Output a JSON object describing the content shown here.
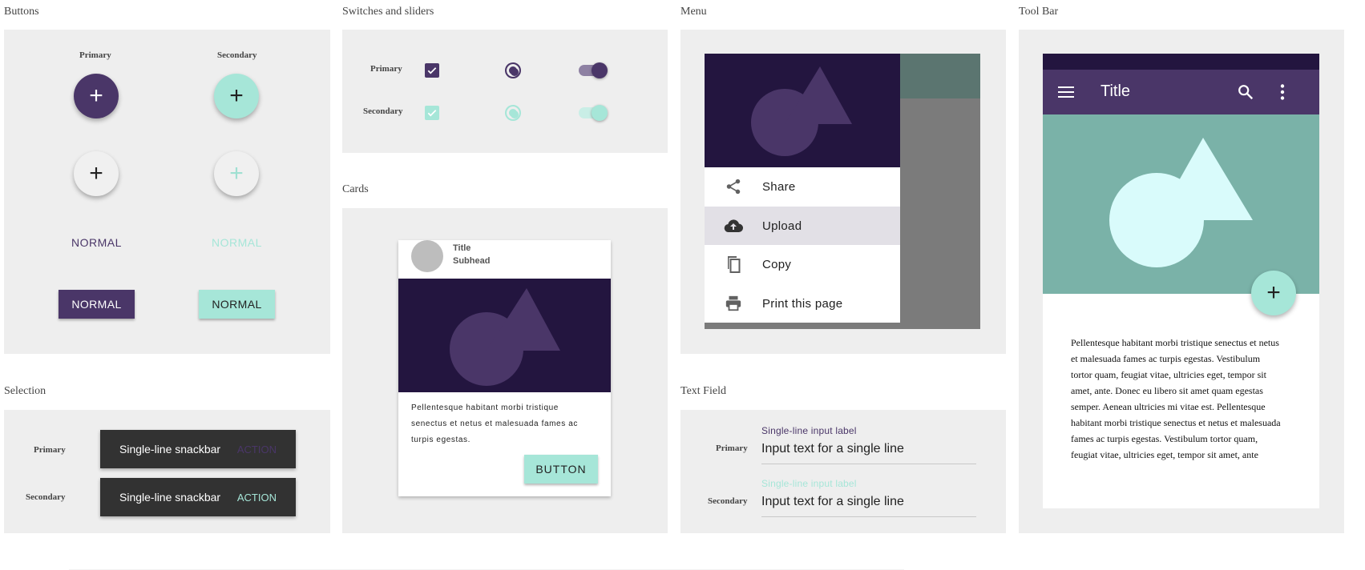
{
  "sections": {
    "buttons": "Buttons",
    "switches": "Switches and sliders",
    "menu": "Menu",
    "toolbar": "Tool Bar",
    "cards": "Cards",
    "selection": "Selection",
    "textfield": "Text Field"
  },
  "buttons": {
    "col_primary": "Primary",
    "col_secondary": "Secondary",
    "fab_glyph": "+",
    "flat_primary": "NORMAL",
    "flat_secondary": "NORMAL",
    "raised_primary": "NORMAL",
    "raised_secondary": "NORMAL"
  },
  "switches": {
    "row_primary": "Primary",
    "row_secondary": "Secondary"
  },
  "menu": {
    "items": [
      {
        "label": "Share",
        "icon": "share-icon"
      },
      {
        "label": "Upload",
        "icon": "cloud-upload-icon"
      },
      {
        "label": "Copy",
        "icon": "copy-icon"
      },
      {
        "label": "Print this page",
        "icon": "print-icon"
      }
    ]
  },
  "toolbar": {
    "title": "Title",
    "body": "Pellentesque habitant morbi tristique senectus et netus et malesuada fames ac turpis egestas. Vestibulum tortor quam, feugiat vitae, ultricies eget, tempor sit amet, ante. Donec eu libero sit amet quam egestas semper. Aenean ultricies mi vitae est. Pellentesque habitant morbi tristique senectus et netus et malesuada fames ac turpis egestas. Vestibulum tortor quam, feugiat vitae, ultricies eget, tempor sit amet, ante",
    "fab_glyph": "+"
  },
  "card": {
    "title": "Title",
    "subhead": "Subhead",
    "body": "Pellentesque habitant morbi tristique senectus et netus et malesuada fames ac turpis egestas.",
    "button": "BUTTON"
  },
  "selection": {
    "row_primary": "Primary",
    "row_secondary": "Secondary",
    "snack_text": "Single-line snackbar",
    "snack_action": "ACTION"
  },
  "textfield": {
    "row_primary": "Primary",
    "row_secondary": "Secondary",
    "label": "Single-line input label",
    "value": "Input text for a single line"
  },
  "colors": {
    "primary": "#4a3668",
    "primary_dark": "#23153f",
    "secondary": "#a6e6d8",
    "toolbar_hero": "#7ab2a8",
    "shape_light": "#d9fbfb"
  }
}
